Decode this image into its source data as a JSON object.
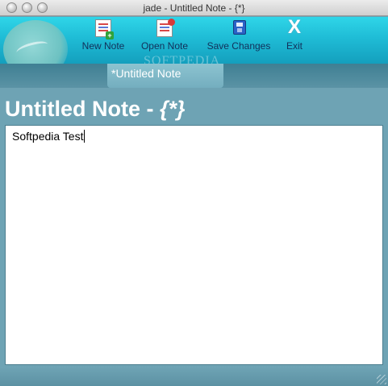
{
  "window": {
    "title": "jade - Untitled Note - {*}"
  },
  "toolbar": {
    "watermark": "SOFTPEDIA",
    "buttons": [
      {
        "label": "New Note",
        "icon": "new-note-icon"
      },
      {
        "label": "Open Note",
        "icon": "open-note-icon"
      },
      {
        "label": "Save Changes",
        "icon": "save-icon"
      },
      {
        "label": "Exit",
        "icon": "exit-icon"
      }
    ]
  },
  "tabs": [
    {
      "label": "*Untitled Note",
      "active": true
    }
  ],
  "note": {
    "title_main": "Untitled Note - ",
    "title_brace": "{*}",
    "content": "Softpedia Test"
  },
  "colors": {
    "toolbar_accent": "#1fbcd6",
    "background": "#6ea3b4"
  }
}
